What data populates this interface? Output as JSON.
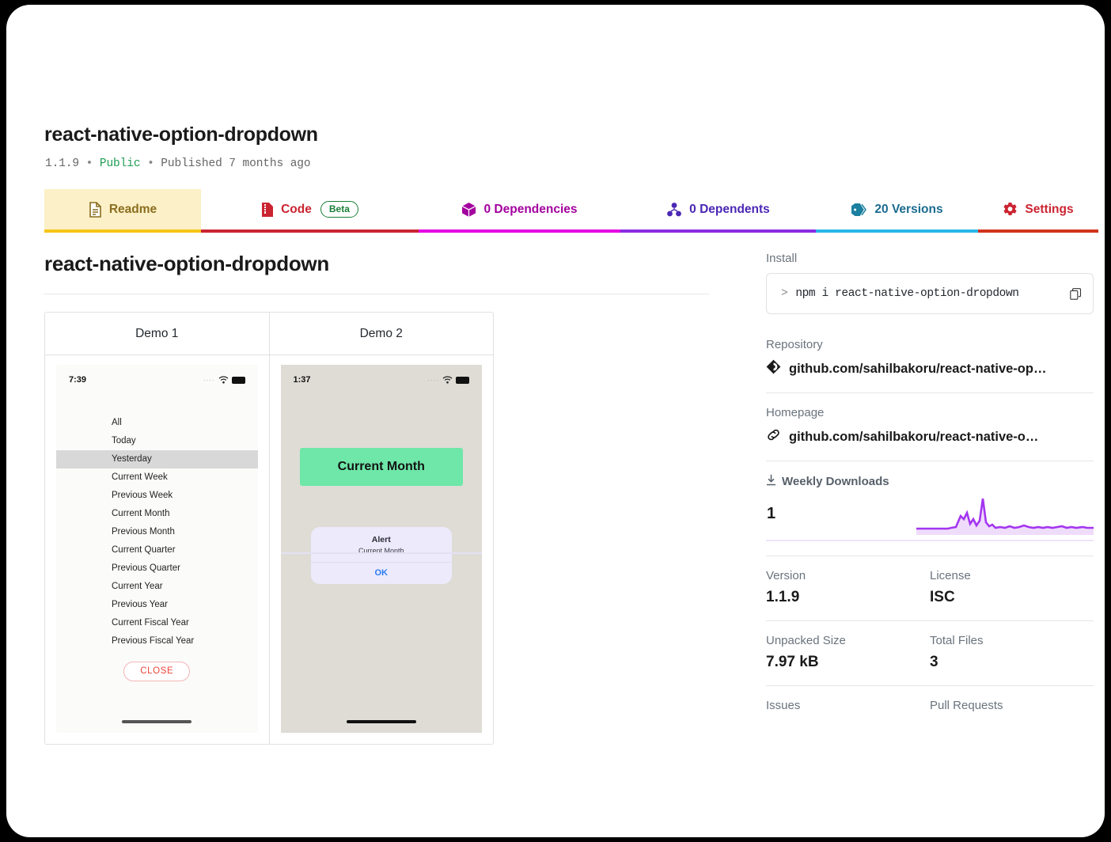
{
  "header": {
    "package_name": "react-native-option-dropdown",
    "version": "1.1.9",
    "visibility": "Public",
    "published": "Published 7 months ago",
    "separator": "•"
  },
  "tabs": [
    {
      "label": "Readme",
      "icon": "readme-doc-icon",
      "color": "#8a6d1f",
      "underline": "#f5c518",
      "bg": "#fbf0c7",
      "active": true
    },
    {
      "label": "Code",
      "icon": "code-file-icon",
      "color": "#cb2431",
      "underline": "#cb2431",
      "badge": "Beta"
    },
    {
      "label": "0 Dependencies",
      "icon": "cube-icon",
      "color": "#a3009e",
      "underline": "#e400e4"
    },
    {
      "label": "0 Dependents",
      "icon": "dependents-icon",
      "color": "#4b27b5",
      "underline": "#8a2be2"
    },
    {
      "label": "20 Versions",
      "icon": "tag-icon",
      "color": "#1b6b8f",
      "underline": "#29b6e8"
    },
    {
      "label": "Settings",
      "icon": "gear-icon",
      "color": "#cb2431",
      "underline": "#d0341c"
    }
  ],
  "readme": {
    "title": "react-native-option-dropdown",
    "demo_table": {
      "headers": [
        "Demo 1",
        "Demo 2"
      ]
    },
    "demo1": {
      "status_time": "7:39",
      "options": [
        "All",
        "Today",
        "Yesterday",
        "Current Week",
        "Previous Week",
        "Current Month",
        "Previous Month",
        "Current Quarter",
        "Previous Quarter",
        "Current Year",
        "Previous Year",
        "Current Fiscal Year",
        "Previous Fiscal Year"
      ],
      "selected_option": "Yesterday",
      "close_label": "CLOSE"
    },
    "demo2": {
      "status_time": "1:37",
      "button_label": "Current Month",
      "alert_title": "Alert",
      "alert_message": "Current Month",
      "alert_ok": "OK"
    }
  },
  "sidebar": {
    "install_label": "Install",
    "install_prompt": ">",
    "install_command": "npm i react-native-option-dropdown",
    "copy_icon": "copy-icon",
    "repository_label": "Repository",
    "repository_value": "github.com/sahilbakoru/react-native-op…",
    "repository_icon": "github-icon",
    "homepage_label": "Homepage",
    "homepage_value": "github.com/sahilbakoru/react-native-o…",
    "homepage_icon": "link-icon",
    "downloads_label": "Weekly Downloads",
    "downloads_icon": "download-icon",
    "downloads_count": "1",
    "version_label": "Version",
    "version_value": "1.1.9",
    "license_label": "License",
    "license_value": "ISC",
    "unpacked_label": "Unpacked Size",
    "unpacked_value": "7.97 kB",
    "files_label": "Total Files",
    "files_value": "3",
    "issues_label": "Issues",
    "pulls_label": "Pull Requests",
    "chart_accent": "#a436f0"
  }
}
